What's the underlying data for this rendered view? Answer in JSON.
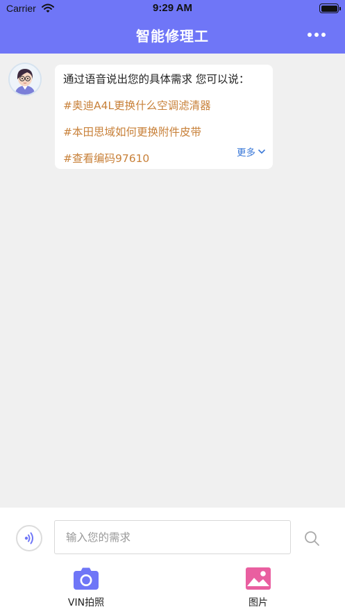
{
  "status_bar": {
    "carrier": "Carrier",
    "time": "9:29 AM"
  },
  "nav": {
    "title": "智能修理工",
    "more_icon": "more-dots-icon"
  },
  "chat": {
    "avatar_icon": "assistant-avatar",
    "intro": "通过语音说出您的具体需求 您可以说：",
    "suggestions": [
      "#奥迪A4L更换什么空调滤清器",
      "#本田思域如何更换附件皮带",
      "#查看编码97610"
    ],
    "more_label": "更多"
  },
  "input_bar": {
    "voice_icon": "voice-icon",
    "placeholder": "输入您的需求",
    "value": "",
    "search_icon": "search-icon"
  },
  "tools": [
    {
      "label": "VIN拍照",
      "icon": "camera-icon",
      "color": "#6f76f7"
    },
    {
      "label": "图片",
      "icon": "image-icon",
      "color": "#e95fa0"
    }
  ],
  "colors": {
    "accent": "#6f76f7",
    "suggestion": "#c8813a",
    "link": "#3a78d8"
  }
}
